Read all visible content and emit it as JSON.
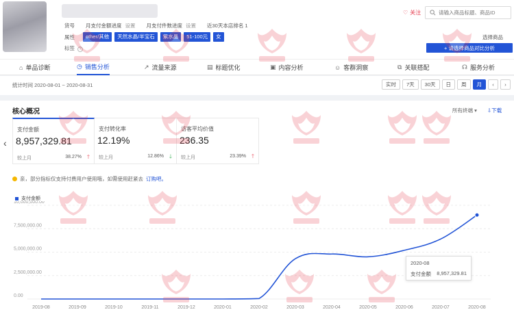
{
  "header": {
    "meta": [
      {
        "key": "货号",
        "sub": ""
      },
      {
        "key": "月支付金额进度",
        "sub": "设置"
      },
      {
        "key": "月支付件数进度",
        "sub": "设置"
      },
      {
        "key": "近30天本店排名 1",
        "sub": ""
      }
    ],
    "attr_label": "属性",
    "tags": [
      "other/其他",
      "天然水晶/半宝石",
      "紫水晶",
      "51-100元",
      "女"
    ],
    "label_text": "标签",
    "follow_label": "关注",
    "search_placeholder": "请输入商品标题、商品ID",
    "select_goods": "选择商品",
    "compare_button": "+ 请选择商品对比分析"
  },
  "tabs": [
    {
      "label": "单品诊断",
      "icon": "⌂"
    },
    {
      "label": "销售分析",
      "icon": "◷"
    },
    {
      "label": "流量来源",
      "icon": "↗"
    },
    {
      "label": "标题优化",
      "icon": "▤"
    },
    {
      "label": "内容分析",
      "icon": "▣"
    },
    {
      "label": "客群洞察",
      "icon": "☺"
    },
    {
      "label": "关联搭配",
      "icon": "⧉"
    },
    {
      "label": "服务分析",
      "icon": "☊"
    }
  ],
  "timebar": {
    "period": "统计时间 2020-08-01 ~ 2020-08-31",
    "buttons": [
      "实时",
      "7天",
      "30天",
      "日",
      "周",
      "月"
    ],
    "prev": "‹",
    "next": "›"
  },
  "core": {
    "title": "核心概况",
    "terminals": "所有终端 ▾",
    "download": "⇩下载",
    "cards": [
      {
        "title": "支付金额",
        "value": "8,957,329.81",
        "compare": "较上月",
        "pct": "38.27%",
        "dir": "up"
      },
      {
        "title": "支付转化率",
        "value": "12.19%",
        "compare": "较上月",
        "pct": "12.86%",
        "dir": "down"
      },
      {
        "title": "访客平均价值",
        "value": "236.35",
        "compare": "较上月",
        "pct": "23.39%",
        "dir": "up"
      }
    ],
    "notice_text": "亲，部分指标仅支持付费用户使用哦，如需使用赶紧去",
    "notice_link": "订购吧。"
  },
  "tooltip": {
    "date": "2020-08",
    "label": "支付金额",
    "value": "8,957,329.81"
  },
  "chart_data": {
    "type": "line",
    "x": [
      "2019-08",
      "2019-09",
      "2019-10",
      "2019-11",
      "2019-12",
      "2020-01",
      "2020-02",
      "2020-03",
      "2020-04",
      "2020-05",
      "2020-06",
      "2020-07",
      "2020-08"
    ],
    "series": [
      {
        "name": "支付金额",
        "values": [
          0,
          0,
          0,
          0,
          0,
          0,
          50000,
          4300000,
          4800000,
          4500000,
          5200000,
          6400000,
          8957329.81
        ]
      }
    ],
    "yticks": [
      "0.00",
      "2,500,000.00",
      "5,000,000.00",
      "7,500,000.00",
      "10,000,000.00"
    ],
    "ylim": [
      0,
      10000000
    ],
    "grid": true,
    "legend": "top-left",
    "color": "#2254d6"
  }
}
